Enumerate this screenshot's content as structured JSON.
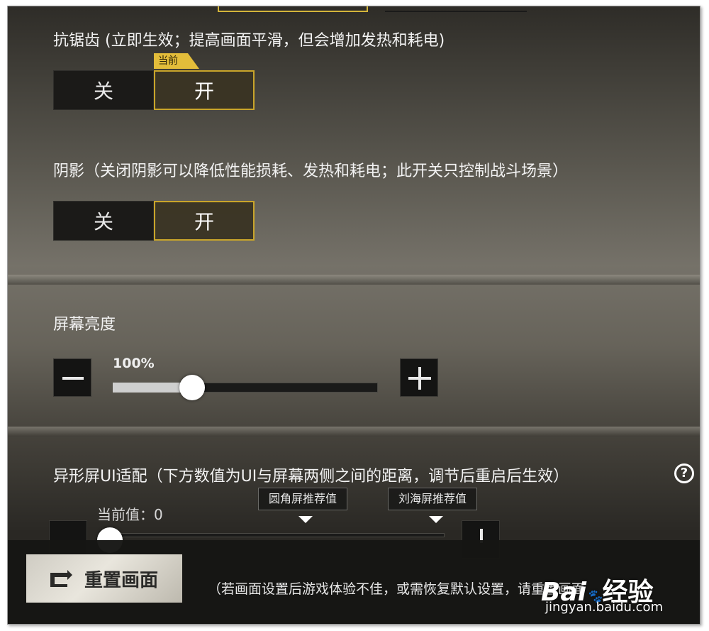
{
  "antialias": {
    "title": "抗锯齿 (立即生效；提高画面平滑，但会增加发热和耗电)",
    "badge": "当前",
    "off_label": "关",
    "on_label": "开",
    "selected": "开"
  },
  "shadow": {
    "title": "阴影（关闭阴影可以降低性能损耗、发热和耗电；此开关只控制战斗场景）",
    "off_label": "关",
    "on_label": "开",
    "selected": "开"
  },
  "brightness": {
    "title": "屏幕亮度",
    "value_text": "100%",
    "fill_fraction": 0.3
  },
  "notch": {
    "title": "异形屏UI适配（下方数值为UI与屏幕两侧之间的距离，调节后重启后生效）",
    "help_symbol": "?",
    "current_value_text": "当前值：0",
    "recommend_rounded": "圆角屏推荐值",
    "recommend_notch": "刘海屏推荐值"
  },
  "footer": {
    "reset_label": "重置画面",
    "hint": "（若画面设置后游戏体验不佳，或需恢复默认设置，请重置画面"
  },
  "watermark": {
    "brand": "Bai",
    "brand_suffix": "经验",
    "url": "jingyan.baidu.com"
  },
  "colors": {
    "accent": "#c9a52a",
    "badge": "#e3bd3a"
  }
}
